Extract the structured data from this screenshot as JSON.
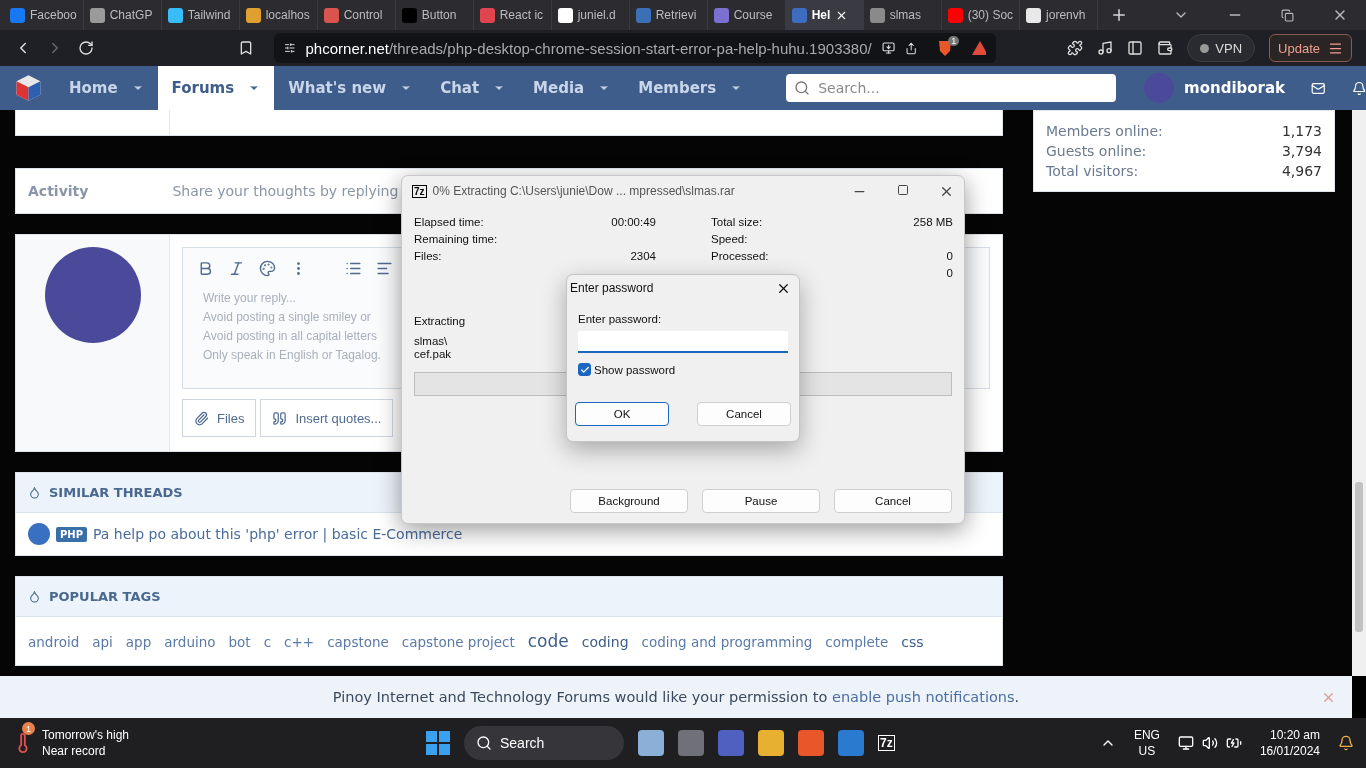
{
  "browser": {
    "tabs": [
      {
        "label": "Faceboo",
        "selected": false,
        "color": "#1877f2"
      },
      {
        "label": "ChatGP",
        "selected": false,
        "color": "#9a9a9a"
      },
      {
        "label": "Tailwind",
        "selected": false,
        "color": "#38bdf8"
      },
      {
        "label": "localhos",
        "selected": false,
        "color": "#e0a030"
      },
      {
        "label": "Control",
        "selected": false,
        "color": "#d9534f"
      },
      {
        "label": "Button",
        "selected": false,
        "color": "#000000"
      },
      {
        "label": "React ic",
        "selected": false,
        "color": "#e0454f"
      },
      {
        "label": "juniel.d",
        "selected": false,
        "color": "#ffffff"
      },
      {
        "label": "Retrievi",
        "selected": false,
        "color": "#3b6fb6"
      },
      {
        "label": "Course",
        "selected": false,
        "color": "#7b6fd0"
      },
      {
        "label": "Hel",
        "selected": true,
        "color": "#3d6cc0"
      },
      {
        "label": "slmas",
        "selected": false,
        "color": "#8a8a8a"
      },
      {
        "label": "(30) Soc",
        "selected": false,
        "color": "#ff0000"
      },
      {
        "label": "jorenvh",
        "selected": false,
        "color": "#e8e8e8"
      }
    ],
    "address": {
      "domain": "phcorner.net",
      "path": "/threads/php-desktop-chrome-session-start-error-pa-help-huhu.1903380/"
    },
    "shield_badge": "1",
    "vpn": "VPN",
    "update": "Update"
  },
  "site": {
    "nav": [
      {
        "label": "Home",
        "selected": false
      },
      {
        "label": "Forums",
        "selected": true
      },
      {
        "label": "What's new",
        "selected": false
      },
      {
        "label": "Chat",
        "selected": false
      },
      {
        "label": "Media",
        "selected": false
      },
      {
        "label": "Members",
        "selected": false
      }
    ],
    "search": {
      "placeholder": "Search..."
    },
    "user": "mondiborak"
  },
  "stats": [
    {
      "label": "Members online:",
      "value": "1,173"
    },
    {
      "label": "Guests online:",
      "value": "3,794"
    },
    {
      "label": "Total visitors:",
      "value": "4,967"
    }
  ],
  "activity": {
    "label": "Activity",
    "text": "Share your thoughts by replying"
  },
  "editor": {
    "hints": [
      "Write your reply...",
      "Avoid posting a single smiley or",
      "Avoid posting in all capital letters",
      "Only speak in English or Tagalog."
    ],
    "buttons": [
      "Files",
      "Insert quotes..."
    ]
  },
  "similar_threads": {
    "title": "SIMILAR THREADS",
    "items": [
      {
        "tag": "PHP",
        "title": "Pa help po about this 'php' error | basic E-Commerce"
      }
    ]
  },
  "popular_tags": {
    "title": "POPULAR TAGS",
    "tags": [
      {
        "label": "android",
        "kind": "normal"
      },
      {
        "label": "api",
        "kind": "normal"
      },
      {
        "label": "app",
        "kind": "normal"
      },
      {
        "label": "arduino",
        "kind": "normal"
      },
      {
        "label": "bot",
        "kind": "normal"
      },
      {
        "label": "c",
        "kind": "normal"
      },
      {
        "label": "c++",
        "kind": "normal"
      },
      {
        "label": "capstone",
        "kind": "normal"
      },
      {
        "label": "capstone project",
        "kind": "normal"
      },
      {
        "label": "code",
        "kind": "large"
      },
      {
        "label": "coding",
        "kind": "medium"
      },
      {
        "label": "coding and programming",
        "kind": "normal"
      },
      {
        "label": "complete",
        "kind": "normal"
      },
      {
        "label": "css",
        "kind": "medium"
      }
    ]
  },
  "notification": {
    "text": "Pinoy Internet and Technology Forums would like your permission to",
    "link": "enable push notifications",
    "end": "."
  },
  "extract_window": {
    "icon": "7z",
    "title": "0% Extracting C:\\Users\\junie\\Dow ... mpressed\\slmas.rar",
    "left": [
      {
        "label": "Elapsed time:",
        "value": "00:00:49"
      },
      {
        "label": "Remaining time:"
      },
      {
        "label": "Files:",
        "value": "2304"
      }
    ],
    "right": [
      {
        "label": "Total size:",
        "value": "258 MB"
      },
      {
        "label": "Speed:"
      },
      {
        "label": "Processed:",
        "value": "0"
      },
      {
        "value": "0"
      }
    ],
    "extracting": "Extracting",
    "path_lines": [
      "slmas\\",
      "cef.pak"
    ],
    "level": 0,
    "buttons": [
      "Background",
      "Pause",
      "Cancel"
    ]
  },
  "password_dialog": {
    "title": "Enter password",
    "label": "Enter password:",
    "show_password": {
      "label": "Show password",
      "checked": true
    },
    "buttons": [
      {
        "label": "OK",
        "selected": true
      },
      {
        "label": "Cancel",
        "selected": false
      }
    ]
  },
  "taskbar": {
    "weather": {
      "badge": "1",
      "line1": "Tomorrow's high",
      "line2": "Near record"
    },
    "search": "Search",
    "app_label": "7z",
    "lang": [
      "ENG",
      "US"
    ],
    "time": "10:20 am",
    "date": "16/01/2024"
  }
}
